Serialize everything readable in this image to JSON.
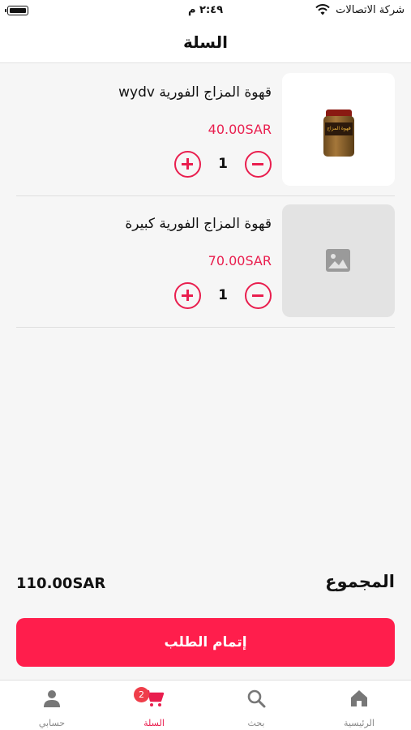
{
  "status_bar": {
    "time": "٢:٤٩ م",
    "carrier": "شركة الاتصالات"
  },
  "header": {
    "title": "السلة"
  },
  "cart": {
    "items": [
      {
        "name": "قهوة المزاج الفورية wydv",
        "price": "40.00SAR",
        "quantity": "1",
        "image": "coffee-jar",
        "image_label": "قهوة المزاج"
      },
      {
        "name": "قهوة المزاج الفورية كبيرة",
        "price": "70.00SAR",
        "quantity": "1",
        "image": "image-placeholder-icon"
      }
    ],
    "total_label": "المجموع",
    "total_value": "110.00SAR",
    "checkout_label": "إتمام الطلب"
  },
  "nav": {
    "items": [
      {
        "label": "الرئيسية",
        "icon": "home-icon"
      },
      {
        "label": "بحث",
        "icon": "search-icon"
      },
      {
        "label": "السلة",
        "icon": "cart-icon",
        "badge": "2",
        "active": true
      },
      {
        "label": "حسابي",
        "icon": "account-icon"
      }
    ]
  },
  "colors": {
    "accent": "#e91e4e",
    "checkout_button": "#ff1e4c",
    "badge": "#ef3e4a"
  }
}
